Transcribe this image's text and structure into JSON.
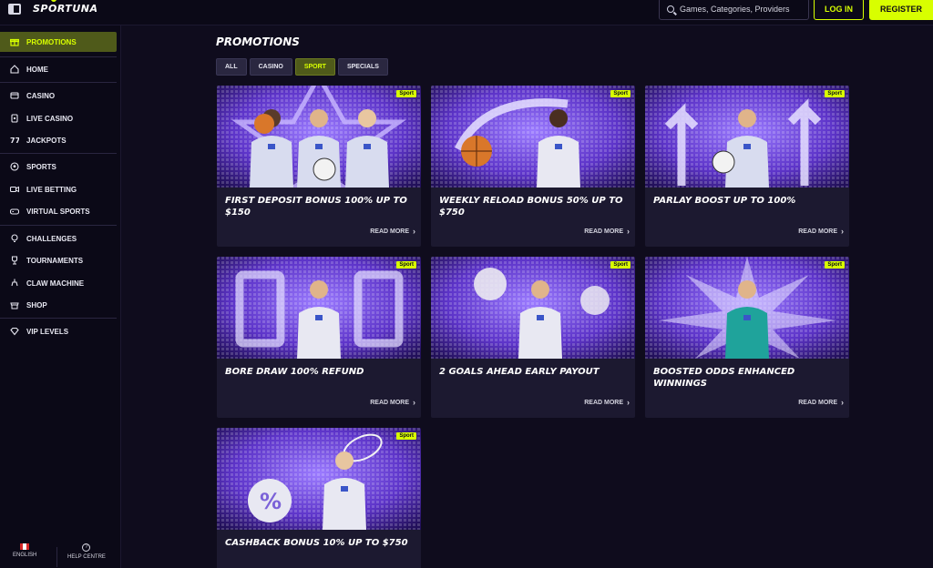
{
  "header": {
    "logo": "SPORTUNA",
    "search_placeholder": "Games, Categories, Providers",
    "login_label": "LOG IN",
    "register_label": "REGISTER"
  },
  "sidebar": {
    "items": [
      {
        "label": "PROMOTIONS",
        "icon": "gift-icon",
        "active": true
      },
      {
        "label": "HOME",
        "icon": "home-icon"
      },
      {
        "label": "CASINO",
        "icon": "casino-icon"
      },
      {
        "label": "LIVE CASINO",
        "icon": "live-casino-icon"
      },
      {
        "label": "JACKPOTS",
        "icon": "jackpot-icon"
      },
      {
        "label": "SPORTS",
        "icon": "soccer-ball-icon"
      },
      {
        "label": "LIVE BETTING",
        "icon": "live-video-icon"
      },
      {
        "label": "VIRTUAL SPORTS",
        "icon": "gamepad-icon"
      },
      {
        "label": "CHALLENGES",
        "icon": "lightbulb-icon"
      },
      {
        "label": "TOURNAMENTS",
        "icon": "trophy-icon"
      },
      {
        "label": "CLAW MACHINE",
        "icon": "claw-icon"
      },
      {
        "label": "SHOP",
        "icon": "shop-icon"
      },
      {
        "label": "VIP LEVELS",
        "icon": "diamond-icon"
      }
    ],
    "footer": {
      "language": "ENGLISH",
      "help": "HELP CENTRE"
    }
  },
  "main": {
    "title": "PROMOTIONS",
    "filters": [
      {
        "label": "ALL"
      },
      {
        "label": "CASINO"
      },
      {
        "label": "SPORT",
        "active": true
      },
      {
        "label": "SPECIALS"
      }
    ],
    "read_more_label": "READ MORE",
    "cards": [
      {
        "badge": "Sport",
        "title": "FIRST DEPOSIT BONUS 100% UP TO $150",
        "jersey": "#d8dcef",
        "scene": "trio"
      },
      {
        "badge": "Sport",
        "title": "WEEKLY RELOAD BONUS 50% UP TO $750",
        "jersey": "#e8e8f2",
        "scene": "basketball"
      },
      {
        "badge": "Sport",
        "title": "PARLAY BOOST UP TO 100%",
        "jersey": "#d8dcef",
        "scene": "arrows"
      },
      {
        "badge": "Sport",
        "title": "BORE DRAW 100% REFUND",
        "jersey": "#e8e8f2",
        "scene": "scoreboard"
      },
      {
        "badge": "Sport",
        "title": "2 GOALS AHEAD EARLY PAYOUT",
        "jersey": "#e8e8f2",
        "scene": "balls"
      },
      {
        "badge": "Sport",
        "title": "BOOSTED ODDS ENHANCED WINNINGS",
        "jersey": "#1fa39b",
        "scene": "burst"
      },
      {
        "badge": "Sport",
        "title": "CASHBACK BONUS 10% UP TO $750",
        "jersey": "#e8e8f2",
        "scene": "tennis"
      }
    ]
  }
}
